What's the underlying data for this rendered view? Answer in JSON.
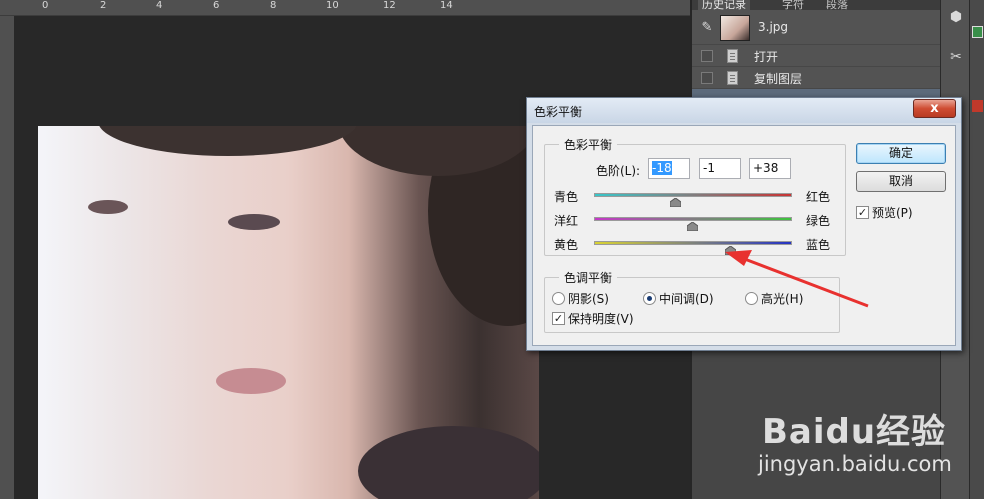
{
  "ruler": {
    "ticks": [
      "0",
      "2",
      "4",
      "6",
      "8",
      "10",
      "12",
      "14"
    ]
  },
  "history_panel": {
    "tabs": [
      "历史记录",
      "字符",
      "段落"
    ],
    "snapshot_name": "3.jpg",
    "items": [
      {
        "label": "打开"
      },
      {
        "label": "复制图层"
      }
    ]
  },
  "dialog": {
    "title": "色彩平衡",
    "close_label": "x",
    "color_balance": {
      "group_title": "色彩平衡",
      "levels_label": "色阶(L):",
      "levels": [
        "-18",
        "-1",
        "+38"
      ],
      "sliders": [
        {
          "left": "青色",
          "right": "红色",
          "value": -18
        },
        {
          "left": "洋红",
          "right": "绿色",
          "value": -1
        },
        {
          "left": "黄色",
          "right": "蓝色",
          "value": 38
        }
      ]
    },
    "tone_balance": {
      "group_title": "色调平衡",
      "options": [
        "阴影(S)",
        "中间调(D)",
        "高光(H)"
      ],
      "selected": "中间调(D)",
      "preserve_luminosity_label": "保持明度(V)",
      "preserve_luminosity": true
    },
    "buttons": {
      "ok": "确定",
      "cancel": "取消"
    },
    "preview_label": "预览(P)",
    "preview_checked": true
  },
  "watermark": {
    "logo": "Baidu经验",
    "url": "jingyan.baidu.com"
  },
  "colors": {
    "accent_arrow": "#e8312f",
    "selection": "#3399ff",
    "close_button": "#cf4d33"
  }
}
